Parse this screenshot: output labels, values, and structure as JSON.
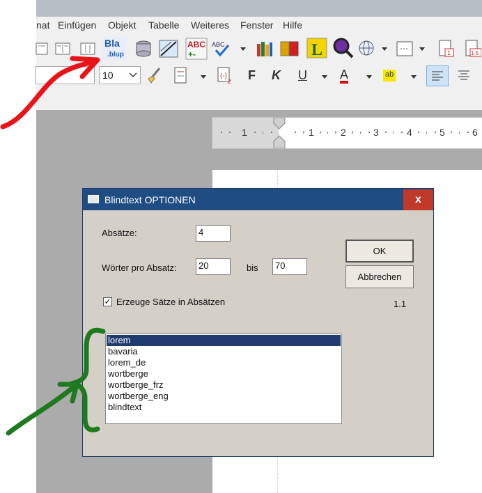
{
  "menu": {
    "items": [
      "nat",
      "Einfügen",
      "Objekt",
      "Tabelle",
      "Weiteres",
      "Fenster",
      "Hilfe"
    ]
  },
  "toolbar2": {
    "font_size": "10",
    "bold_label": "F",
    "italic_label": "K",
    "underline_label": "U",
    "font_color_label": "A",
    "highlight_label": "ab"
  },
  "ruler": {
    "numbers": [
      "1",
      "1",
      "2",
      "3",
      "4",
      "5",
      "6"
    ]
  },
  "dialog": {
    "title": "Blindtext OPTIONEN",
    "close_label": "x",
    "absaetze_label": "Absätze:",
    "absaetze_value": "4",
    "woerter_label": "Wörter pro Absatz:",
    "woerter_from": "20",
    "bis_label": "bis",
    "woerter_to": "70",
    "checkbox_label": "Erzeuge Sätze in Absätzen",
    "checkbox_checked": true,
    "ok_label": "OK",
    "cancel_label": "Abbrechen",
    "version": "1.1",
    "list_items": [
      "lorem",
      "bavaria",
      "lorem_de",
      "wortberge",
      "wortberge_frz",
      "wortberge_eng",
      "blindtext"
    ],
    "selected_item": "lorem"
  },
  "colors": {
    "dialog_title_bg": "#1f4c82",
    "close_bg": "#c0392b",
    "selection_bg": "#1f3b70",
    "annotation_red": "#e8141a",
    "annotation_green": "#1e7a1e"
  }
}
